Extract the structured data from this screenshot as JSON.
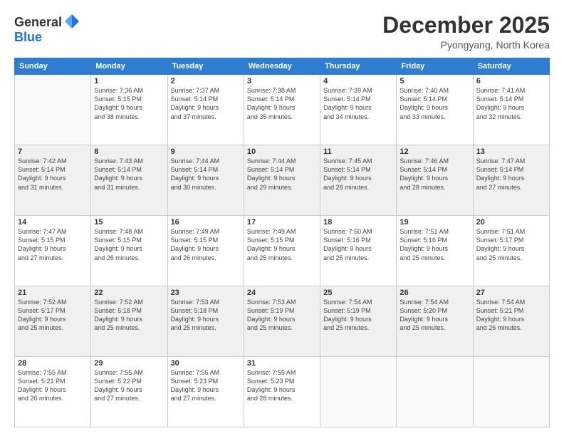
{
  "logo": {
    "general": "General",
    "blue": "Blue"
  },
  "header": {
    "month": "December 2025",
    "location": "Pyongyang, North Korea"
  },
  "weekdays": [
    "Sunday",
    "Monday",
    "Tuesday",
    "Wednesday",
    "Thursday",
    "Friday",
    "Saturday"
  ],
  "rows": [
    {
      "shaded": false,
      "days": [
        {
          "num": "",
          "info": ""
        },
        {
          "num": "1",
          "info": "Sunrise: 7:36 AM\nSunset: 5:15 PM\nDaylight: 9 hours\nand 38 minutes."
        },
        {
          "num": "2",
          "info": "Sunrise: 7:37 AM\nSunset: 5:14 PM\nDaylight: 9 hours\nand 37 minutes."
        },
        {
          "num": "3",
          "info": "Sunrise: 7:38 AM\nSunset: 5:14 PM\nDaylight: 9 hours\nand 35 minutes."
        },
        {
          "num": "4",
          "info": "Sunrise: 7:39 AM\nSunset: 5:14 PM\nDaylight: 9 hours\nand 34 minutes."
        },
        {
          "num": "5",
          "info": "Sunrise: 7:40 AM\nSunset: 5:14 PM\nDaylight: 9 hours\nand 33 minutes."
        },
        {
          "num": "6",
          "info": "Sunrise: 7:41 AM\nSunset: 5:14 PM\nDaylight: 9 hours\nand 32 minutes."
        }
      ]
    },
    {
      "shaded": true,
      "days": [
        {
          "num": "7",
          "info": "Sunrise: 7:42 AM\nSunset: 5:14 PM\nDaylight: 9 hours\nand 31 minutes."
        },
        {
          "num": "8",
          "info": "Sunrise: 7:43 AM\nSunset: 5:14 PM\nDaylight: 9 hours\nand 31 minutes."
        },
        {
          "num": "9",
          "info": "Sunrise: 7:44 AM\nSunset: 5:14 PM\nDaylight: 9 hours\nand 30 minutes."
        },
        {
          "num": "10",
          "info": "Sunrise: 7:44 AM\nSunset: 5:14 PM\nDaylight: 9 hours\nand 29 minutes."
        },
        {
          "num": "11",
          "info": "Sunrise: 7:45 AM\nSunset: 5:14 PM\nDaylight: 9 hours\nand 28 minutes."
        },
        {
          "num": "12",
          "info": "Sunrise: 7:46 AM\nSunset: 5:14 PM\nDaylight: 9 hours\nand 28 minutes."
        },
        {
          "num": "13",
          "info": "Sunrise: 7:47 AM\nSunset: 5:14 PM\nDaylight: 9 hours\nand 27 minutes."
        }
      ]
    },
    {
      "shaded": false,
      "days": [
        {
          "num": "14",
          "info": "Sunrise: 7:47 AM\nSunset: 5:15 PM\nDaylight: 9 hours\nand 27 minutes."
        },
        {
          "num": "15",
          "info": "Sunrise: 7:48 AM\nSunset: 5:15 PM\nDaylight: 9 hours\nand 26 minutes."
        },
        {
          "num": "16",
          "info": "Sunrise: 7:49 AM\nSunset: 5:15 PM\nDaylight: 9 hours\nand 26 minutes."
        },
        {
          "num": "17",
          "info": "Sunrise: 7:49 AM\nSunset: 5:15 PM\nDaylight: 9 hours\nand 25 minutes."
        },
        {
          "num": "18",
          "info": "Sunrise: 7:50 AM\nSunset: 5:16 PM\nDaylight: 9 hours\nand 25 minutes."
        },
        {
          "num": "19",
          "info": "Sunrise: 7:51 AM\nSunset: 5:16 PM\nDaylight: 9 hours\nand 25 minutes."
        },
        {
          "num": "20",
          "info": "Sunrise: 7:51 AM\nSunset: 5:17 PM\nDaylight: 9 hours\nand 25 minutes."
        }
      ]
    },
    {
      "shaded": true,
      "days": [
        {
          "num": "21",
          "info": "Sunrise: 7:52 AM\nSunset: 5:17 PM\nDaylight: 9 hours\nand 25 minutes."
        },
        {
          "num": "22",
          "info": "Sunrise: 7:52 AM\nSunset: 5:18 PM\nDaylight: 9 hours\nand 25 minutes."
        },
        {
          "num": "23",
          "info": "Sunrise: 7:53 AM\nSunset: 5:18 PM\nDaylight: 9 hours\nand 25 minutes."
        },
        {
          "num": "24",
          "info": "Sunrise: 7:53 AM\nSunset: 5:19 PM\nDaylight: 9 hours\nand 25 minutes."
        },
        {
          "num": "25",
          "info": "Sunrise: 7:54 AM\nSunset: 5:19 PM\nDaylight: 9 hours\nand 25 minutes."
        },
        {
          "num": "26",
          "info": "Sunrise: 7:54 AM\nSunset: 5:20 PM\nDaylight: 9 hours\nand 25 minutes."
        },
        {
          "num": "27",
          "info": "Sunrise: 7:54 AM\nSunset: 5:21 PM\nDaylight: 9 hours\nand 26 minutes."
        }
      ]
    },
    {
      "shaded": false,
      "days": [
        {
          "num": "28",
          "info": "Sunrise: 7:55 AM\nSunset: 5:21 PM\nDaylight: 9 hours\nand 26 minutes."
        },
        {
          "num": "29",
          "info": "Sunrise: 7:55 AM\nSunset: 5:22 PM\nDaylight: 9 hours\nand 27 minutes."
        },
        {
          "num": "30",
          "info": "Sunrise: 7:55 AM\nSunset: 5:23 PM\nDaylight: 9 hours\nand 27 minutes."
        },
        {
          "num": "31",
          "info": "Sunrise: 7:55 AM\nSunset: 5:23 PM\nDaylight: 9 hours\nand 28 minutes."
        },
        {
          "num": "",
          "info": ""
        },
        {
          "num": "",
          "info": ""
        },
        {
          "num": "",
          "info": ""
        }
      ]
    }
  ]
}
